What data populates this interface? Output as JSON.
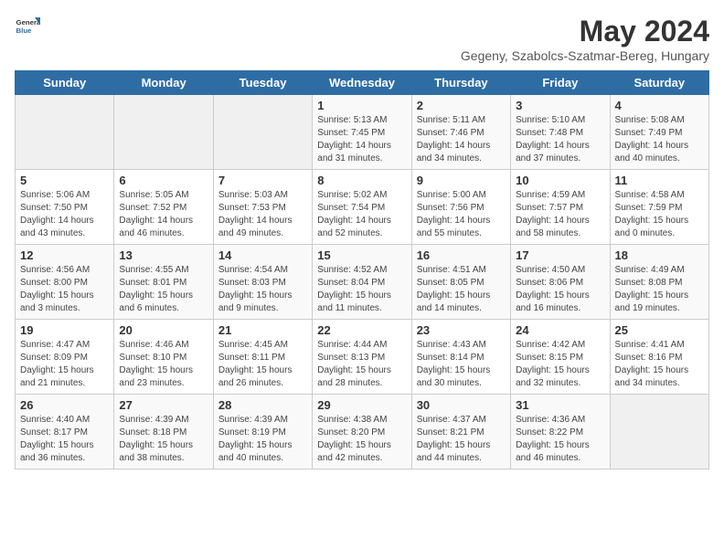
{
  "header": {
    "logo_general": "General",
    "logo_blue": "Blue",
    "month_year": "May 2024",
    "location": "Gegeny, Szabolcs-Szatmar-Bereg, Hungary"
  },
  "days_of_week": [
    "Sunday",
    "Monday",
    "Tuesday",
    "Wednesday",
    "Thursday",
    "Friday",
    "Saturday"
  ],
  "weeks": [
    [
      {
        "num": "",
        "sunrise": "",
        "sunset": "",
        "daylight": ""
      },
      {
        "num": "",
        "sunrise": "",
        "sunset": "",
        "daylight": ""
      },
      {
        "num": "",
        "sunrise": "",
        "sunset": "",
        "daylight": ""
      },
      {
        "num": "1",
        "sunrise": "Sunrise: 5:13 AM",
        "sunset": "Sunset: 7:45 PM",
        "daylight": "Daylight: 14 hours and 31 minutes."
      },
      {
        "num": "2",
        "sunrise": "Sunrise: 5:11 AM",
        "sunset": "Sunset: 7:46 PM",
        "daylight": "Daylight: 14 hours and 34 minutes."
      },
      {
        "num": "3",
        "sunrise": "Sunrise: 5:10 AM",
        "sunset": "Sunset: 7:48 PM",
        "daylight": "Daylight: 14 hours and 37 minutes."
      },
      {
        "num": "4",
        "sunrise": "Sunrise: 5:08 AM",
        "sunset": "Sunset: 7:49 PM",
        "daylight": "Daylight: 14 hours and 40 minutes."
      }
    ],
    [
      {
        "num": "5",
        "sunrise": "Sunrise: 5:06 AM",
        "sunset": "Sunset: 7:50 PM",
        "daylight": "Daylight: 14 hours and 43 minutes."
      },
      {
        "num": "6",
        "sunrise": "Sunrise: 5:05 AM",
        "sunset": "Sunset: 7:52 PM",
        "daylight": "Daylight: 14 hours and 46 minutes."
      },
      {
        "num": "7",
        "sunrise": "Sunrise: 5:03 AM",
        "sunset": "Sunset: 7:53 PM",
        "daylight": "Daylight: 14 hours and 49 minutes."
      },
      {
        "num": "8",
        "sunrise": "Sunrise: 5:02 AM",
        "sunset": "Sunset: 7:54 PM",
        "daylight": "Daylight: 14 hours and 52 minutes."
      },
      {
        "num": "9",
        "sunrise": "Sunrise: 5:00 AM",
        "sunset": "Sunset: 7:56 PM",
        "daylight": "Daylight: 14 hours and 55 minutes."
      },
      {
        "num": "10",
        "sunrise": "Sunrise: 4:59 AM",
        "sunset": "Sunset: 7:57 PM",
        "daylight": "Daylight: 14 hours and 58 minutes."
      },
      {
        "num": "11",
        "sunrise": "Sunrise: 4:58 AM",
        "sunset": "Sunset: 7:59 PM",
        "daylight": "Daylight: 15 hours and 0 minutes."
      }
    ],
    [
      {
        "num": "12",
        "sunrise": "Sunrise: 4:56 AM",
        "sunset": "Sunset: 8:00 PM",
        "daylight": "Daylight: 15 hours and 3 minutes."
      },
      {
        "num": "13",
        "sunrise": "Sunrise: 4:55 AM",
        "sunset": "Sunset: 8:01 PM",
        "daylight": "Daylight: 15 hours and 6 minutes."
      },
      {
        "num": "14",
        "sunrise": "Sunrise: 4:54 AM",
        "sunset": "Sunset: 8:03 PM",
        "daylight": "Daylight: 15 hours and 9 minutes."
      },
      {
        "num": "15",
        "sunrise": "Sunrise: 4:52 AM",
        "sunset": "Sunset: 8:04 PM",
        "daylight": "Daylight: 15 hours and 11 minutes."
      },
      {
        "num": "16",
        "sunrise": "Sunrise: 4:51 AM",
        "sunset": "Sunset: 8:05 PM",
        "daylight": "Daylight: 15 hours and 14 minutes."
      },
      {
        "num": "17",
        "sunrise": "Sunrise: 4:50 AM",
        "sunset": "Sunset: 8:06 PM",
        "daylight": "Daylight: 15 hours and 16 minutes."
      },
      {
        "num": "18",
        "sunrise": "Sunrise: 4:49 AM",
        "sunset": "Sunset: 8:08 PM",
        "daylight": "Daylight: 15 hours and 19 minutes."
      }
    ],
    [
      {
        "num": "19",
        "sunrise": "Sunrise: 4:47 AM",
        "sunset": "Sunset: 8:09 PM",
        "daylight": "Daylight: 15 hours and 21 minutes."
      },
      {
        "num": "20",
        "sunrise": "Sunrise: 4:46 AM",
        "sunset": "Sunset: 8:10 PM",
        "daylight": "Daylight: 15 hours and 23 minutes."
      },
      {
        "num": "21",
        "sunrise": "Sunrise: 4:45 AM",
        "sunset": "Sunset: 8:11 PM",
        "daylight": "Daylight: 15 hours and 26 minutes."
      },
      {
        "num": "22",
        "sunrise": "Sunrise: 4:44 AM",
        "sunset": "Sunset: 8:13 PM",
        "daylight": "Daylight: 15 hours and 28 minutes."
      },
      {
        "num": "23",
        "sunrise": "Sunrise: 4:43 AM",
        "sunset": "Sunset: 8:14 PM",
        "daylight": "Daylight: 15 hours and 30 minutes."
      },
      {
        "num": "24",
        "sunrise": "Sunrise: 4:42 AM",
        "sunset": "Sunset: 8:15 PM",
        "daylight": "Daylight: 15 hours and 32 minutes."
      },
      {
        "num": "25",
        "sunrise": "Sunrise: 4:41 AM",
        "sunset": "Sunset: 8:16 PM",
        "daylight": "Daylight: 15 hours and 34 minutes."
      }
    ],
    [
      {
        "num": "26",
        "sunrise": "Sunrise: 4:40 AM",
        "sunset": "Sunset: 8:17 PM",
        "daylight": "Daylight: 15 hours and 36 minutes."
      },
      {
        "num": "27",
        "sunrise": "Sunrise: 4:39 AM",
        "sunset": "Sunset: 8:18 PM",
        "daylight": "Daylight: 15 hours and 38 minutes."
      },
      {
        "num": "28",
        "sunrise": "Sunrise: 4:39 AM",
        "sunset": "Sunset: 8:19 PM",
        "daylight": "Daylight: 15 hours and 40 minutes."
      },
      {
        "num": "29",
        "sunrise": "Sunrise: 4:38 AM",
        "sunset": "Sunset: 8:20 PM",
        "daylight": "Daylight: 15 hours and 42 minutes."
      },
      {
        "num": "30",
        "sunrise": "Sunrise: 4:37 AM",
        "sunset": "Sunset: 8:21 PM",
        "daylight": "Daylight: 15 hours and 44 minutes."
      },
      {
        "num": "31",
        "sunrise": "Sunrise: 4:36 AM",
        "sunset": "Sunset: 8:22 PM",
        "daylight": "Daylight: 15 hours and 46 minutes."
      },
      {
        "num": "",
        "sunrise": "",
        "sunset": "",
        "daylight": ""
      }
    ]
  ]
}
